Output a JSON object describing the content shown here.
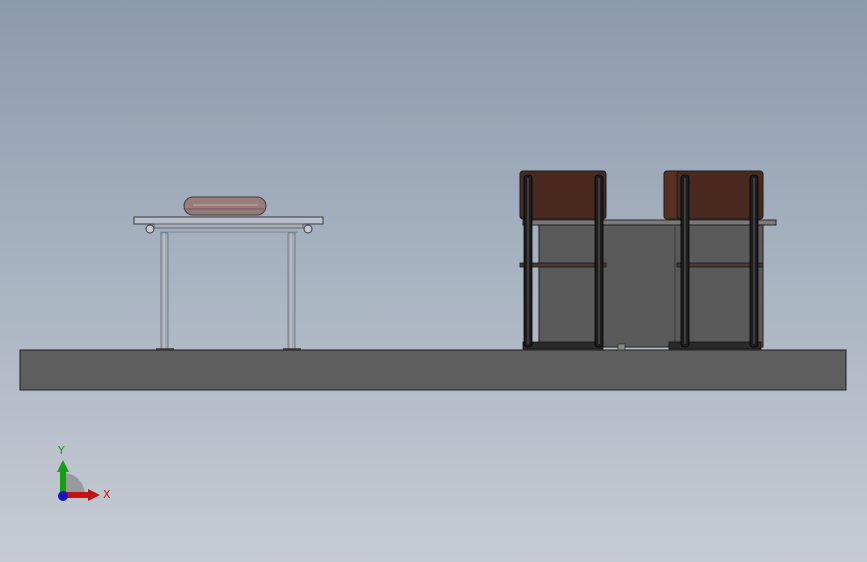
{
  "colors": {
    "viewport_top": "#8c9aad",
    "viewport_bottom": "#c6cbd3",
    "base_plate": "#5e5e5e",
    "table_frame": "#b8bec8",
    "table_legs": "#9aa3ad",
    "pad": "#9a7b7b",
    "cabinet": "#5a5a5a",
    "post": "#1d1d1d",
    "brown_block": "#4a2a1e",
    "x_axis": "#c01414",
    "y_axis": "#12a012",
    "z_axis": "#1414c0"
  },
  "triad": {
    "x_label": "X",
    "y_label": "Y"
  }
}
